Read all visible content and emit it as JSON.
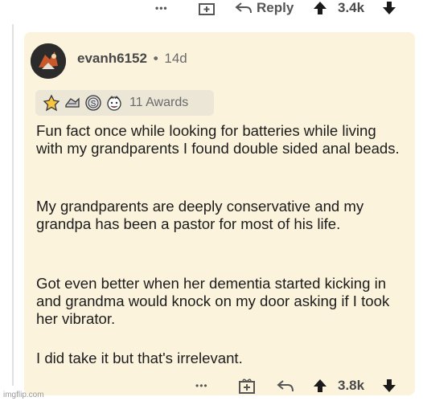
{
  "top_actions": {
    "more_label": "•••",
    "reply_label": "Reply",
    "vote_count": "3.4k"
  },
  "comment": {
    "author": "evanh6152",
    "separator": "•",
    "age": "14d",
    "awards_label": "11 Awards",
    "paragraphs": [
      "Fun fact once while looking for batteries while living with my grandparents I found double sided anal beads.",
      "My grandparents are deeply conservative and my grandpa has been a pastor for most of his life.",
      "Got even better when her dementia started kicking in and grandma would knock on my door asking if I took her vibrator.",
      "I did take it but that's irrelevant."
    ]
  },
  "bottom_actions": {
    "more_label": "•••",
    "vote_count": "3.8k"
  },
  "watermark": "imgflip.com",
  "colors": {
    "comment_bg": "#fbf3dc",
    "awards_bg": "#ebe6d5",
    "upvote": "#1a1a1b"
  }
}
